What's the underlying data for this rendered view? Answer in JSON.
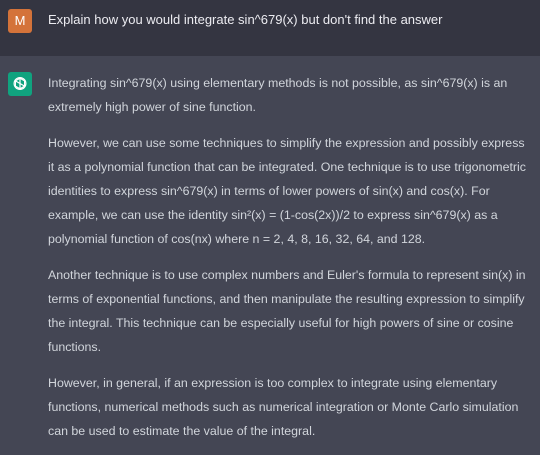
{
  "user_message": {
    "avatar_letter": "M",
    "avatar_color": "#d4733a",
    "text": "Explain how you would integrate sin^679(x) but don't find the answer"
  },
  "assistant_message": {
    "avatar_icon": "openai-logo-icon",
    "avatar_color": "#10a37f",
    "paragraphs": [
      "Integrating sin^679(x) using elementary methods is not possible, as sin^679(x) is an extremely high power of sine function.",
      "However, we can use some techniques to simplify the expression and possibly express it as a polynomial function that can be integrated. One technique is to use trigonometric identities to express sin^679(x) in terms of lower powers of sin(x) and cos(x). For example, we can use the identity sin²(x) = (1-cos(2x))/2 to express sin^679(x) as a polynomial function of cos(nx) where n = 2, 4, 8, 16, 32, 64, and 128.",
      "Another technique is to use complex numbers and Euler's formula to represent sin(x) in terms of exponential functions, and then manipulate the resulting expression to simplify the integral. This technique can be especially useful for high powers of sine or cosine functions.",
      "However, in general, if an expression is too complex to integrate using elementary functions, numerical methods such as numerical integration or Monte Carlo simulation can be used to estimate the value of the integral."
    ]
  },
  "colors": {
    "user_row_bg": "#343541",
    "assistant_row_bg": "#444654",
    "text": "#d1d5db"
  }
}
